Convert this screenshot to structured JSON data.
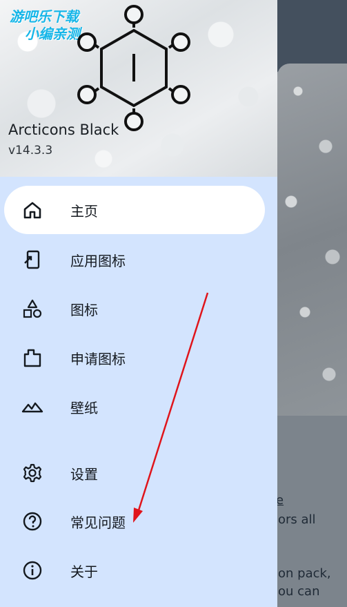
{
  "watermark": {
    "line1": "游吧乐下载",
    "line2": "小编亲测"
  },
  "header": {
    "app_name": "Arcticons Black",
    "version": "v14.3.3"
  },
  "menu": {
    "items": [
      {
        "label": "主页",
        "icon": "home-icon",
        "active": true
      },
      {
        "label": "应用图标",
        "icon": "app-icons-icon",
        "active": false
      },
      {
        "label": "图标",
        "icon": "shapes-icon",
        "active": false
      },
      {
        "label": "申请图标",
        "icon": "request-icon",
        "active": false
      },
      {
        "label": "壁纸",
        "icon": "wallpaper-icon",
        "active": false
      },
      {
        "label": "设置",
        "icon": "gear-icon",
        "active": false
      },
      {
        "label": "常见问题",
        "icon": "help-icon",
        "active": false
      },
      {
        "label": "关于",
        "icon": "info-icon",
        "active": false
      }
    ]
  },
  "background_text": {
    "line1": "e",
    "line2": "ors all",
    "line3": "on pack,",
    "line4": "ou can"
  },
  "colors": {
    "drawer": "#d3e4fe",
    "active_item": "#ffffff",
    "annotation_arrow": "#e0141b",
    "watermark": "#16b6e8"
  }
}
